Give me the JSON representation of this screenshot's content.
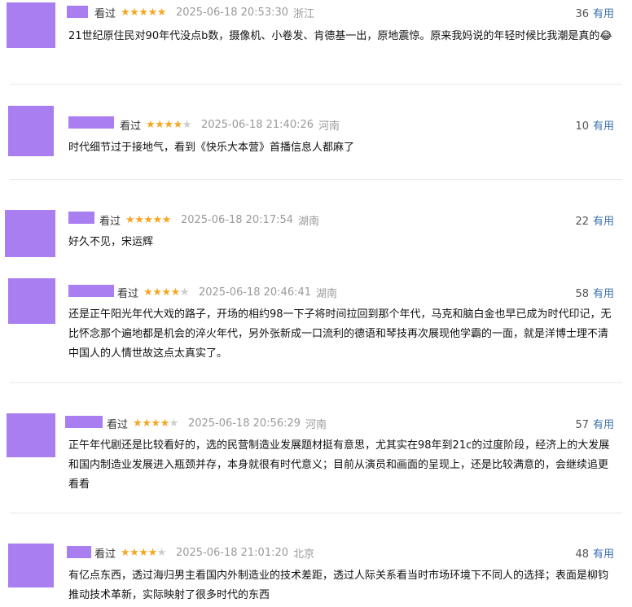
{
  "comments": [
    {
      "watched": "看过",
      "rating": 5,
      "time": "2025-06-18 20:53:30",
      "location": "浙江",
      "useful_count": "36",
      "useful_label": "有用",
      "text": "21世纪原住民对90年代没点b数，摄像机、小卷发、肯德基一出，原地震惊。原来我妈说的年轻时候比我潮是真的😂"
    },
    {
      "watched": "看过",
      "rating": 4,
      "time": "2025-06-18 21:40:26",
      "location": "河南",
      "useful_count": "10",
      "useful_label": "有用",
      "text": "时代细节过于接地气，看到《快乐大本营》首播信息人都麻了"
    },
    {
      "watched": "看过",
      "rating": 5,
      "time": "2025-06-18 20:17:54",
      "location": "湖南",
      "useful_count": "22",
      "useful_label": "有用",
      "text": "好久不见，宋运辉"
    },
    {
      "watched": "看过",
      "rating": 4,
      "time": "2025-06-18 20:46:41",
      "location": "湖南",
      "useful_count": "58",
      "useful_label": "有用",
      "text": "还是正午阳光年代大戏的路子，开场的相约98一下子将时间拉回到那个年代，马克和脑白金也早已成为时代印记，无比怀念那个遍地都是机会的淬火年代，另外张新成一口流利的德语和琴技再次展现他学霸的一面，就是洋博士理不清中国人的人情世故这点太真实了。"
    },
    {
      "watched": "看过",
      "rating": 4,
      "time": "2025-06-18 20:56:29",
      "location": "河南",
      "useful_count": "57",
      "useful_label": "有用",
      "text": "正午年代剧还是比较看好的，选的民营制造业发展题材挺有意思，尤其实在98年到21c的过度阶段，经济上的大发展和国内制造业发展进入瓶颈并存，本身就很有时代意义；目前从演员和画面的呈现上，还是比较满意的，会继续追更看看"
    },
    {
      "watched": "看过",
      "rating": 4,
      "time": "2025-06-18 21:01:20",
      "location": "北京",
      "useful_count": "48",
      "useful_label": "有用",
      "text": "有亿点东西，透过海归男主看国内外制造业的技术差距，透过人际关系看当时市场环境下不同人的选择；表面是柳钧推动技术革新，实际映射了很多时代的东西"
    }
  ]
}
